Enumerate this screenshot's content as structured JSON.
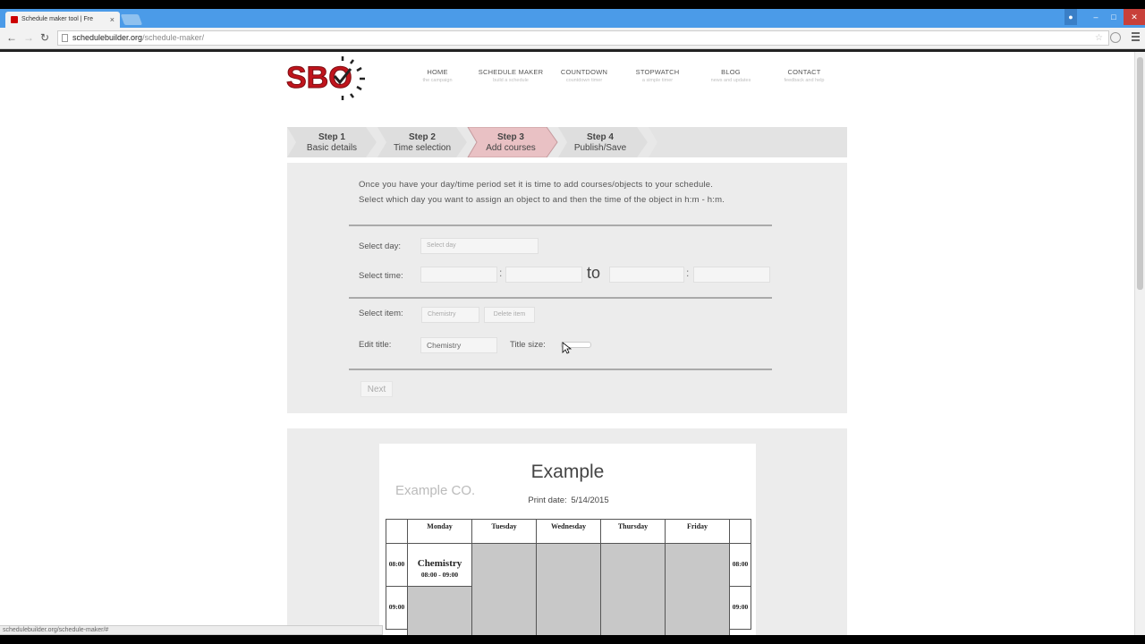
{
  "browser": {
    "tab_title": "Schedule maker tool | Fre",
    "tab_close": "×",
    "url_domain": "schedulebuilder.org",
    "url_path": "/schedule-maker/",
    "status_url": "schedulebuilder.org/schedule-maker/#"
  },
  "site": {
    "logo_text": "SBO",
    "nav": [
      {
        "title": "HOME",
        "sub": "the campaign"
      },
      {
        "title": "SCHEDULE MAKER",
        "sub": "build a schedule"
      },
      {
        "title": "COUNTDOWN",
        "sub": "countdown timer"
      },
      {
        "title": "STOPWATCH",
        "sub": "a simple timer"
      },
      {
        "title": "BLOG",
        "sub": "news and updates"
      },
      {
        "title": "CONTACT",
        "sub": "feedback and help"
      }
    ]
  },
  "steps": [
    {
      "num": "Step 1",
      "desc": "Basic details",
      "active": false
    },
    {
      "num": "Step 2",
      "desc": "Time selection",
      "active": false
    },
    {
      "num": "Step 3",
      "desc": "Add courses",
      "active": true
    },
    {
      "num": "Step 4",
      "desc": "Publish/Save",
      "active": false
    }
  ],
  "form": {
    "intro_line1": "Once you have your day/time period set it is time to add courses/objects to your schedule.",
    "intro_line2": "Select which day you want to assign an object to and then the time of the object in h:m - h:m.",
    "select_day_label": "Select day:",
    "select_day_placeholder": "Select day",
    "select_time_label": "Select time:",
    "time_colon": ":",
    "to_label": "to",
    "select_item_label": "Select item:",
    "select_item_value": "Chemistry",
    "delete_item_label": "Delete item",
    "edit_title_label": "Edit title:",
    "edit_title_value": "Chemistry",
    "title_size_label": "Title size:",
    "next_label": "Next"
  },
  "preview": {
    "title": "Example",
    "company": "Example CO.",
    "print_date_label": "Print date:",
    "print_date": "5/14/2015",
    "days": [
      "Monday",
      "Tuesday",
      "Wednesday",
      "Thursday",
      "Friday"
    ],
    "times": [
      "08:00",
      "09:00"
    ],
    "event": {
      "name": "Chemistry",
      "time": "08:00 - 09:00"
    }
  }
}
